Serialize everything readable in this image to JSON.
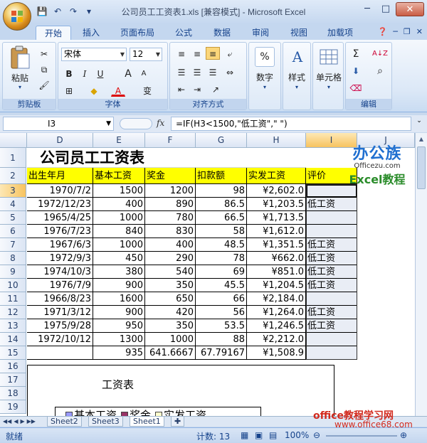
{
  "window": {
    "title": "公司员工工资表1.xls [兼容模式] - Microsoft Excel"
  },
  "qat": {
    "save": "💾",
    "undo": "↶",
    "redo": "↷",
    "more": "▾"
  },
  "tabs": [
    "开始",
    "插入",
    "页面布局",
    "公式",
    "数据",
    "审阅",
    "视图",
    "加载项"
  ],
  "ribbon": {
    "clipboard": {
      "paste": "粘贴",
      "label": "剪贴板"
    },
    "font": {
      "name": "宋体",
      "size": "12",
      "label": "字体",
      "bold": "B",
      "italic": "I",
      "underline": "U",
      "grow": "A",
      "shrink": "A",
      "wen": "变"
    },
    "alignment": {
      "label": "对齐方式"
    },
    "number": {
      "title": "数字",
      "symbol": "%"
    },
    "styles": {
      "title": "样式",
      "symbol": "A"
    },
    "cells": {
      "title": "单元格"
    },
    "editing": {
      "label": "编辑",
      "sum": "Σ",
      "sort": "A↓Z",
      "find": "⌕"
    }
  },
  "formula_bar": {
    "cell_ref": "I3",
    "fx": "fx",
    "formula": "=IF(H3<1500,\"低工资\",\" \")"
  },
  "columns": [
    "D",
    "E",
    "F",
    "G",
    "H",
    "I"
  ],
  "next_col": "J",
  "rows": [
    "1",
    "2",
    "3",
    "4",
    "5",
    "6",
    "7",
    "8",
    "9",
    "10",
    "11",
    "12",
    "13",
    "14",
    "15",
    "16",
    "17",
    "18",
    "19"
  ],
  "sheet": {
    "title": "公司员工工资表",
    "headers": [
      "出生年月",
      "基本工资",
      "奖金",
      "扣款额",
      "实发工资",
      "评价"
    ],
    "data": [
      [
        "1970/7/2",
        "1500",
        "1200",
        "98",
        "¥2,602.0",
        ""
      ],
      [
        "1972/12/23",
        "400",
        "890",
        "86.5",
        "¥1,203.5",
        "低工资"
      ],
      [
        "1965/4/25",
        "1000",
        "780",
        "66.5",
        "¥1,713.5",
        ""
      ],
      [
        "1976/7/23",
        "840",
        "830",
        "58",
        "¥1,612.0",
        ""
      ],
      [
        "1967/6/3",
        "1000",
        "400",
        "48.5",
        "¥1,351.5",
        "低工资"
      ],
      [
        "1972/9/3",
        "450",
        "290",
        "78",
        "¥662.0",
        "低工资"
      ],
      [
        "1974/10/3",
        "380",
        "540",
        "69",
        "¥851.0",
        "低工资"
      ],
      [
        "1976/7/9",
        "900",
        "350",
        "45.5",
        "¥1,204.5",
        "低工资"
      ],
      [
        "1966/8/23",
        "1600",
        "650",
        "66",
        "¥2,184.0",
        ""
      ],
      [
        "1971/3/12",
        "900",
        "420",
        "56",
        "¥1,264.0",
        "低工资"
      ],
      [
        "1975/9/28",
        "950",
        "350",
        "53.5",
        "¥1,246.5",
        "低工资"
      ],
      [
        "1972/10/12",
        "1300",
        "1000",
        "88",
        "¥2,212.0",
        ""
      ],
      [
        "",
        "935",
        "641.6667",
        "67.79167",
        "¥1,508.9",
        ""
      ]
    ]
  },
  "chart": {
    "title": "工资表",
    "legend": [
      "基本工资",
      "奖金",
      "实发工资"
    ],
    "colors": [
      "#9999ff",
      "#993366",
      "#ffffcc"
    ]
  },
  "sheet_tabs": [
    "Sheet2",
    "Sheet3",
    "Sheet1"
  ],
  "status": {
    "mode": "就绪",
    "count_label": "计数: 13",
    "zoom": "100%"
  },
  "watermarks": {
    "brand": "办公族",
    "site": "Officezu.com",
    "tag": "Excel教程",
    "bottom1": "office教程学习网",
    "bottom2": "www.office68.com"
  }
}
